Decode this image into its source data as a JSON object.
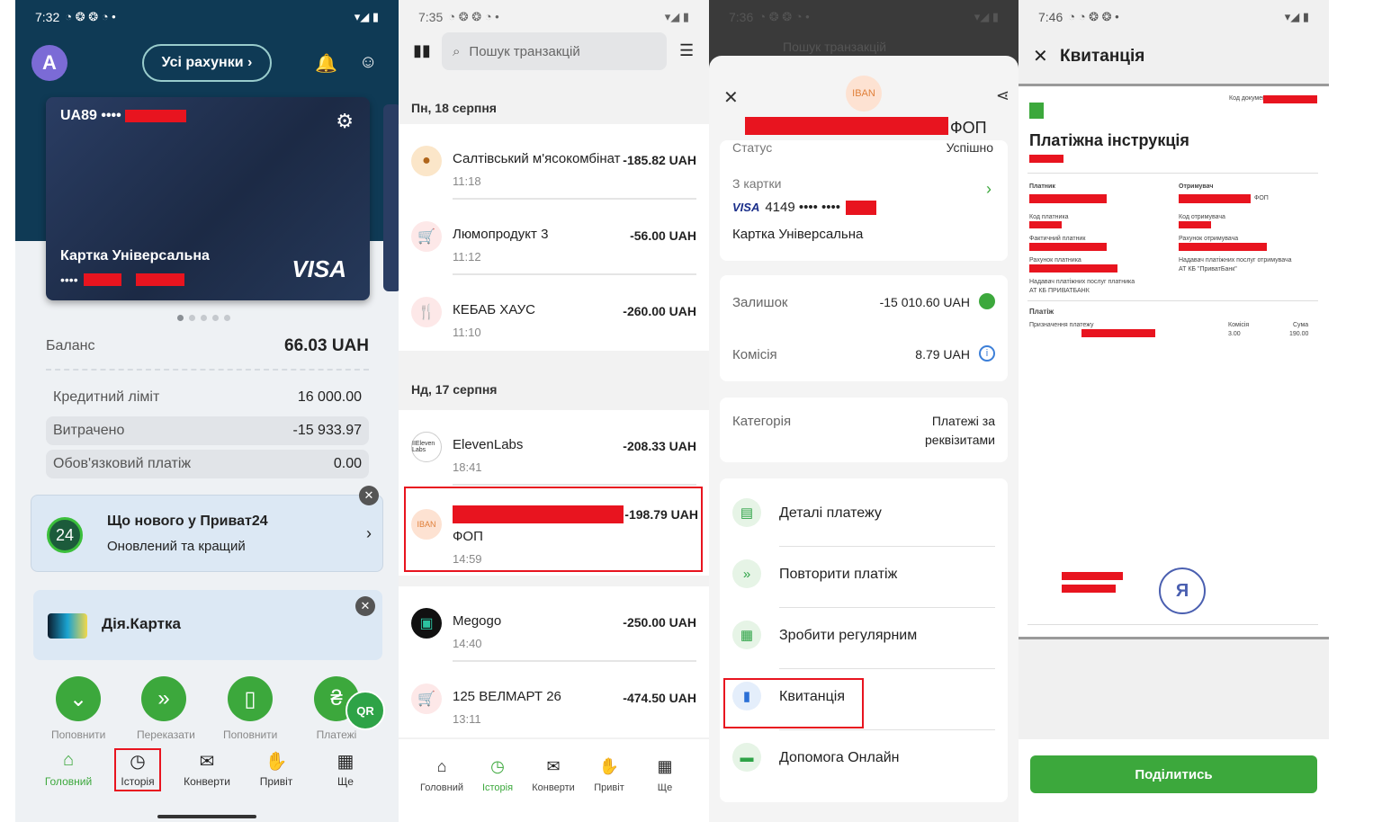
{
  "p1": {
    "status_time": "7:32",
    "avatar_letter": "A",
    "accounts_label": "Усі рахунки",
    "card_number": "UA89 ••••",
    "card_name": "Картка Універсальна",
    "card_mask": "••••",
    "card_brand": "VISA",
    "balance_label": "Баланс",
    "balance_value": "66.03 UAH",
    "credit_label": "Кредитний ліміт",
    "credit_value": "16 000.00",
    "spent_label": "Витрачено",
    "spent_value": "-15 933.97",
    "mandatory_label": "Обов'язковий платіж",
    "mandatory_value": "0.00",
    "promo_badge": "24",
    "promo_title": "Що нового у Приват24",
    "promo_sub": "Оновлений та кращий",
    "dia_label": "Дія.Картка",
    "quick_actions": [
      "Поповнити",
      "Переказати",
      "Поповнити",
      "Платежі"
    ],
    "qr_label": "QR",
    "nav": [
      "Головний",
      "Історія",
      "Конверти",
      "Привіт",
      "Ще"
    ]
  },
  "p2": {
    "status_time": "7:35",
    "search_placeholder": "Пошук транзакцій",
    "date1": "Пн, 18 серпня",
    "date2": "Нд, 17 серпня",
    "tx": [
      {
        "name": "Салтівський м'ясокомбінат",
        "amount": "-185.82 UAH",
        "time": "11:18"
      },
      {
        "name": "Люмопродукт 3",
        "amount": "-56.00 UAH",
        "time": "11:12"
      },
      {
        "name": "КЕБАБ ХАУС",
        "amount": "-260.00 UAH",
        "time": "11:10"
      },
      {
        "name": "ElevenLabs",
        "amount": "-208.33 UAH",
        "time": "18:41"
      },
      {
        "name": "ФОП",
        "amount": "-198.79 UAH",
        "time": "14:59"
      },
      {
        "name": "Megogo",
        "amount": "-250.00 UAH",
        "time": "14:40"
      },
      {
        "name": "125 ВЕЛМАРТ 26",
        "amount": "-474.50 UAH",
        "time": "13:11"
      }
    ],
    "iban_badge": "IBAN",
    "eleven_badge": "IIEleven Labs",
    "nav": [
      "Головний",
      "Історія",
      "Конверти",
      "Привіт",
      "Ще"
    ]
  },
  "p3": {
    "status_time": "7:36",
    "search_placeholder": "Пошук транзакцій",
    "iban_badge": "IBAN",
    "title_suffix": "ФОП",
    "status_label": "Статус",
    "status_value": "Успішно",
    "from_card_label": "З картки",
    "card_brand": "VISA",
    "card_num": "4149 •••• ••••",
    "card_name": "Картка Універсальна",
    "remain_label": "Залишок",
    "remain_value": "-15 010.60 UAH",
    "fee_label": "Комісія",
    "fee_value": "8.79 UAH",
    "category_label": "Категорія",
    "category_value_1": "Платежі за",
    "category_value_2": "реквізитами",
    "actions": [
      "Деталі платежу",
      "Повторити платіж",
      "Зробити регулярним",
      "Квитанція",
      "Допомога Онлайн"
    ]
  },
  "p4": {
    "status_time": "7:46",
    "title": "Квитанція",
    "doc_title": "Платіжна інструкція",
    "doc_code": "Код документа",
    "payer": "Платник",
    "receiver": "Отримувач",
    "payer_code": "Код платника",
    "receiver_code": "Код отримувача",
    "actual_payer": "Фактичний платник",
    "receiver_acc": "Рахунок отримувача",
    "payer_acc": "Рахунок платника",
    "payer_bank_label": "Надавач платіжних послуг платника",
    "payer_bank": "АТ КБ ПРИВАТБАНК",
    "receiver_bank_label": "Надавач платіжних послуг отримувача",
    "receiver_bank": "АТ КБ \"ПриватБанк\"",
    "fop": "ФОП",
    "payment": "Платіж",
    "purpose": "Призначення платежу",
    "fee": "Комісія",
    "sum": "Сума",
    "fee_val": "3.00",
    "sum_val": "190.00",
    "share_label": "Поділитись"
  }
}
